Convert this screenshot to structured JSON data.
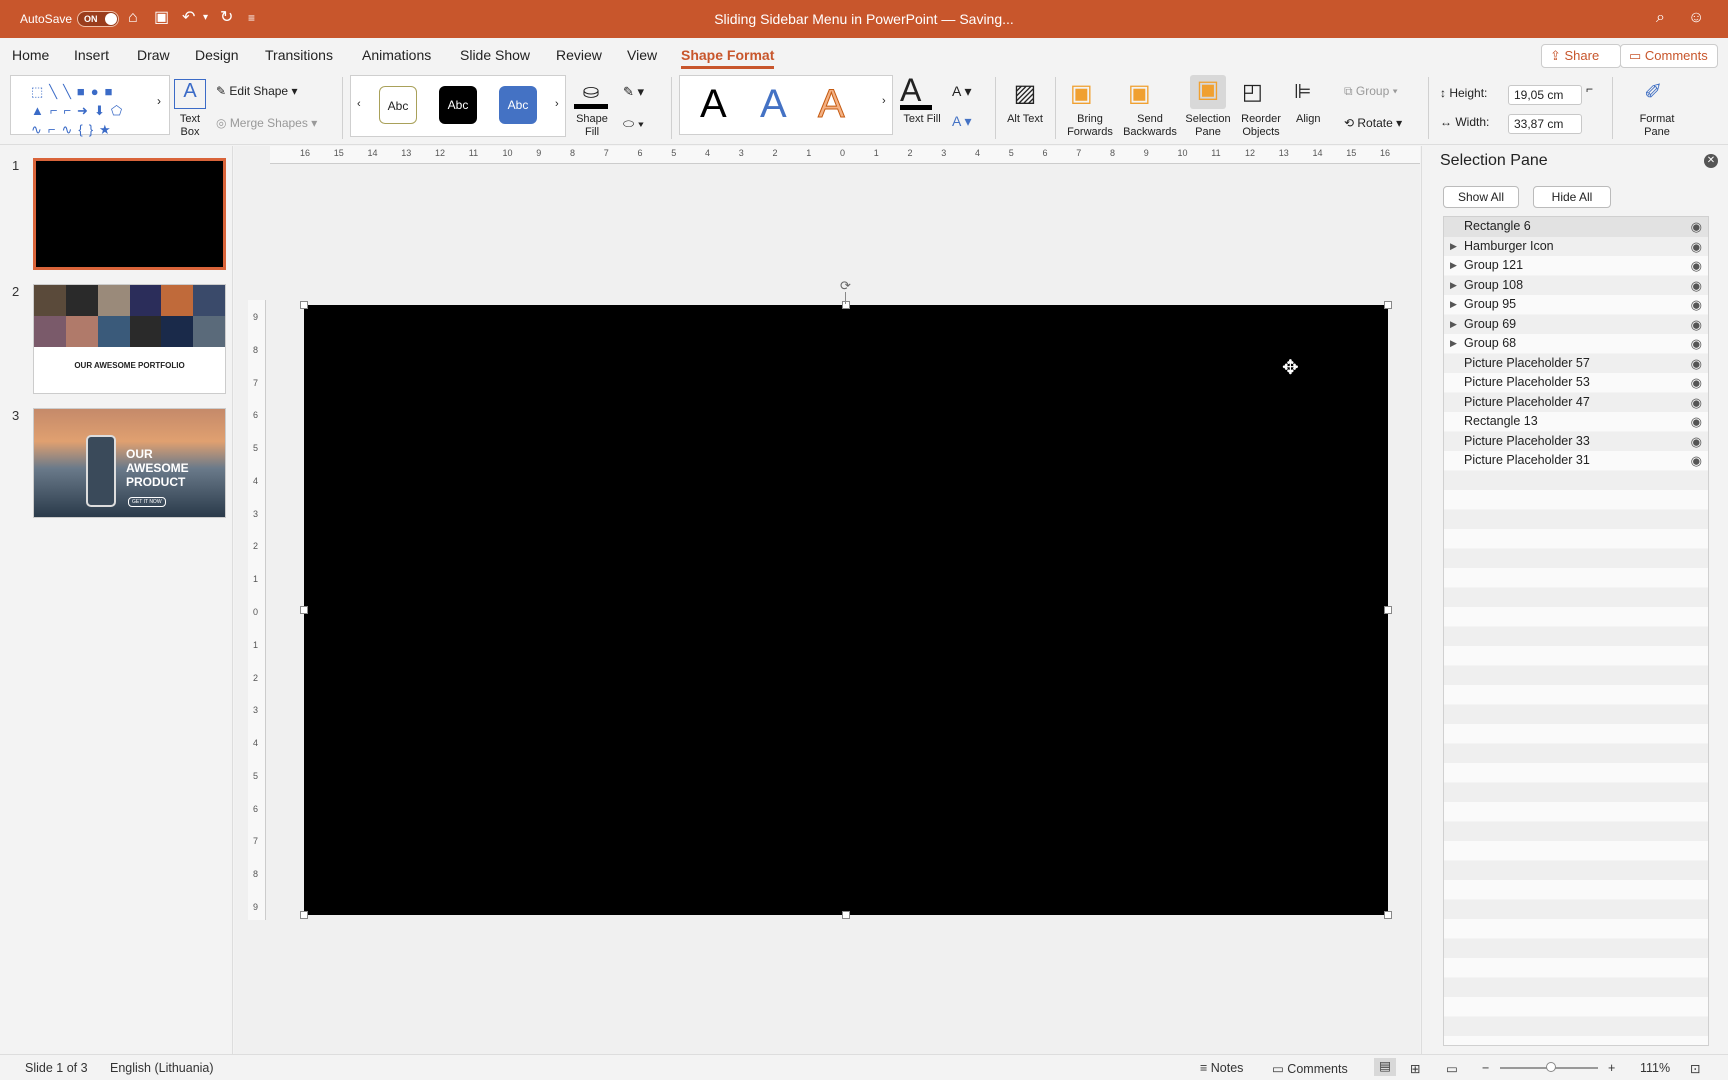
{
  "titlebar": {
    "autosave_label": "AutoSave",
    "autosave_state": "ON",
    "document_title": "Sliding Sidebar Menu in PowerPoint — Saving...",
    "icons": [
      "home-icon",
      "save-icon",
      "undo-icon",
      "redo-icon",
      "customize-icon",
      "search-icon",
      "account-icon"
    ]
  },
  "menu": {
    "tabs": [
      "Home",
      "Insert",
      "Draw",
      "Design",
      "Transitions",
      "Animations",
      "Slide Show",
      "Review",
      "View",
      "Shape Format"
    ],
    "active_tab": "Shape Format",
    "share_label": "Share",
    "comments_label": "Comments"
  },
  "ribbon": {
    "text_box": "Text Box",
    "edit_shape": "Edit Shape",
    "merge_shapes": "Merge Shapes",
    "styles": [
      "Abc",
      "Abc",
      "Abc"
    ],
    "shape_fill": "Shape Fill",
    "wordart": [
      "A",
      "A",
      "A"
    ],
    "text_fill": "Text Fill",
    "alt_text": "Alt Text",
    "bring_forwards": "Bring Forwards",
    "send_backwards": "Send Backwards",
    "selection_pane": "Selection Pane",
    "reorder_objects": "Reorder Objects",
    "align": "Align",
    "group": "Group",
    "rotate": "Rotate",
    "height_label": "Height:",
    "height_value": "19,05 cm",
    "width_label": "Width:",
    "width_value": "33,87 cm",
    "format_pane": "Format Pane",
    "accent_color": "#c8562c"
  },
  "slides": {
    "numbers": [
      "1",
      "2",
      "3"
    ],
    "slide2_title": "OUR AWESOME PORTFOLIO",
    "slide3_title": "OUR AWESOME PRODUCT",
    "slide3_button": "GET IT NOW"
  },
  "ruler": {
    "h_ticks": [
      "16",
      "15",
      "14",
      "13",
      "12",
      "11",
      "10",
      "9",
      "8",
      "7",
      "6",
      "5",
      "4",
      "3",
      "2",
      "1",
      "0",
      "1",
      "2",
      "3",
      "4",
      "5",
      "6",
      "7",
      "8",
      "9",
      "10",
      "11",
      "12",
      "13",
      "14",
      "15",
      "16"
    ],
    "v_ticks": [
      "9",
      "8",
      "7",
      "6",
      "5",
      "4",
      "3",
      "2",
      "1",
      "0",
      "1",
      "2",
      "3",
      "4",
      "5",
      "6",
      "7",
      "8",
      "9"
    ]
  },
  "selection_pane": {
    "title": "Selection Pane",
    "show_all": "Show All",
    "hide_all": "Hide All",
    "items": [
      {
        "name": "Rectangle 6",
        "group": false,
        "selected": true
      },
      {
        "name": "Hamburger Icon",
        "group": true
      },
      {
        "name": "Group 121",
        "group": true
      },
      {
        "name": "Group 108",
        "group": true
      },
      {
        "name": "Group 95",
        "group": true
      },
      {
        "name": "Group 69",
        "group": true
      },
      {
        "name": "Group 68",
        "group": true
      },
      {
        "name": "Picture Placeholder 57",
        "group": false
      },
      {
        "name": "Picture Placeholder 53",
        "group": false
      },
      {
        "name": "Picture Placeholder 47",
        "group": false
      },
      {
        "name": "Rectangle 13",
        "group": false
      },
      {
        "name": "Picture Placeholder 33",
        "group": false
      },
      {
        "name": "Picture Placeholder 31",
        "group": false
      }
    ]
  },
  "status": {
    "slide_info": "Slide 1 of 3",
    "language": "English (Lithuania)",
    "notes": "Notes",
    "comments": "Comments",
    "zoom": "111%"
  }
}
